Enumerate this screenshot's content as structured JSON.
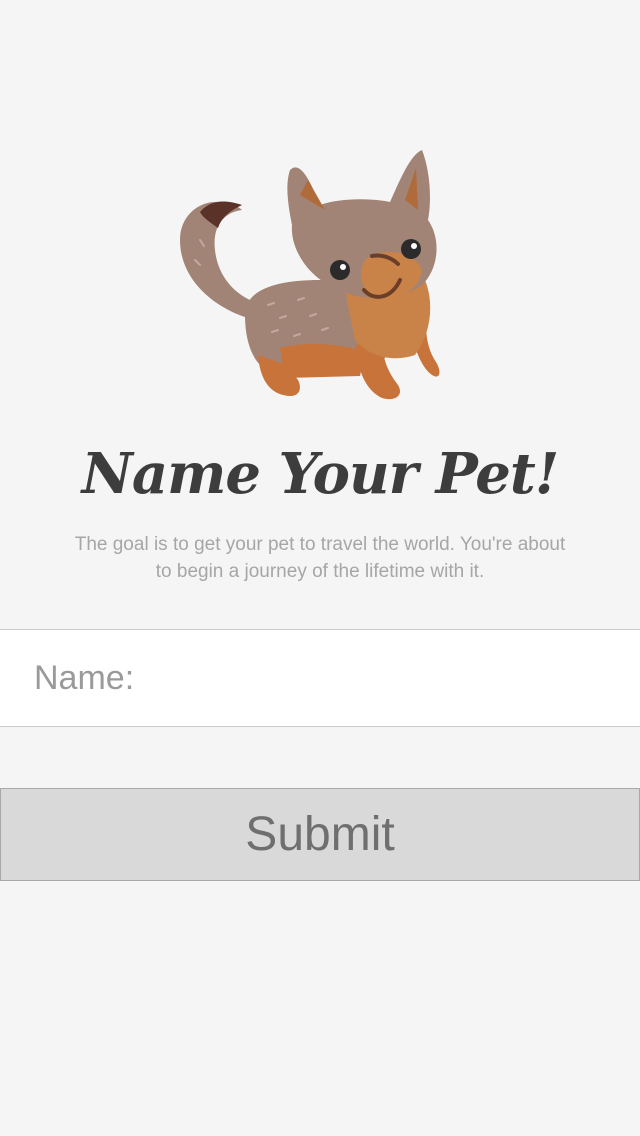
{
  "illustration": {
    "icon": "fox-pet-illustration",
    "colors": {
      "fur": "#a28477",
      "fur_light": "#b39789",
      "chest": "#c98247",
      "legs": "#c7733a",
      "tail_tip": "#5b3228",
      "ear_inner": "#b06b3a",
      "eye": "#2b2b2b"
    }
  },
  "title": "Name Your Pet!",
  "subtitle": "The goal is to get your pet to travel the world. You're about to begin a journey of the lifetime with it.",
  "form": {
    "name_label": "Name:",
    "name_value": "",
    "name_placeholder": "",
    "submit_label": "Submit"
  },
  "colors": {
    "background": "#f5f5f5",
    "title": "#3d3d3d",
    "subtitle": "#a6a6a6",
    "button_bg": "#d9d9d9",
    "button_text": "#6f6f6f"
  }
}
